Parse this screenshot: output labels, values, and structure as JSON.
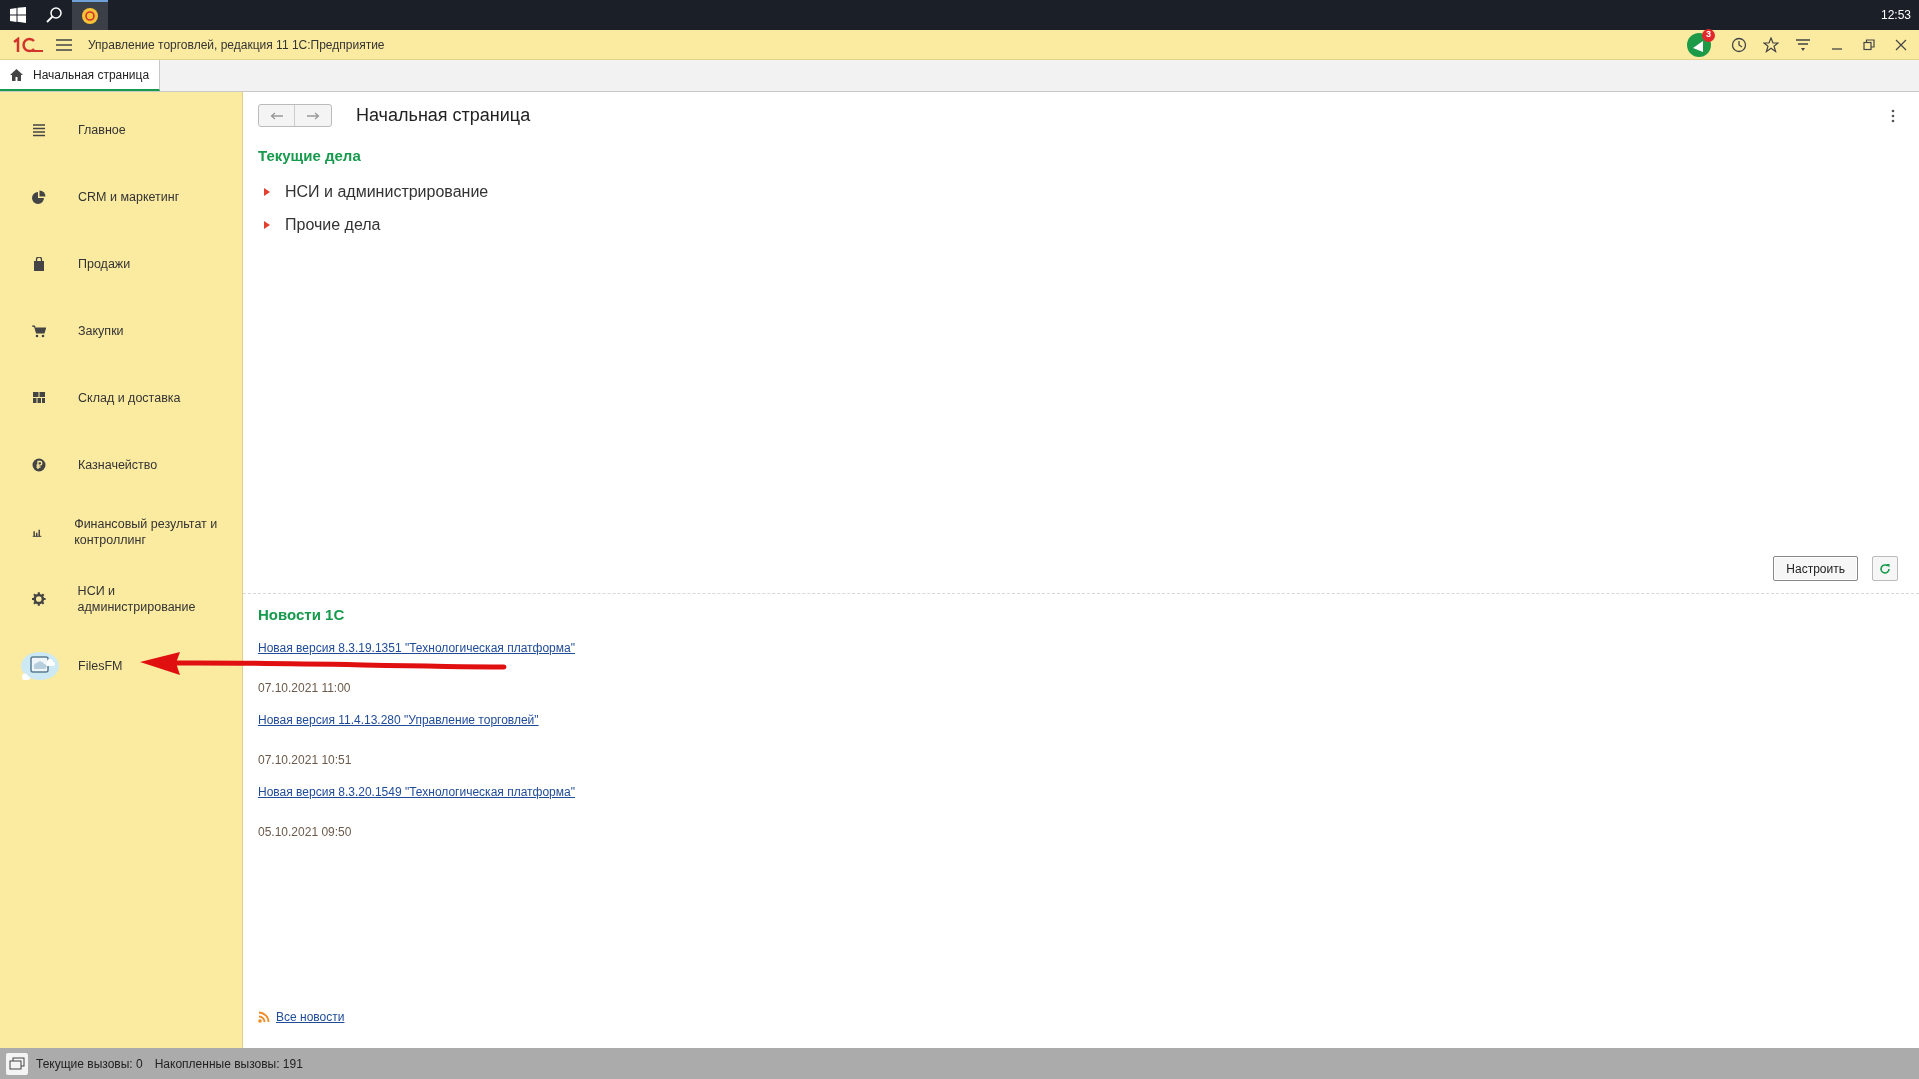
{
  "taskbar": {
    "clock": "12:53"
  },
  "app_header": {
    "title": "Управление торговлей, редакция 11 1С:Предприятие",
    "notification_count": "3"
  },
  "tabs": [
    {
      "label": "Начальная страница",
      "selected": true
    }
  ],
  "sidebar": {
    "items": [
      {
        "label": "Главное"
      },
      {
        "label": "CRM и маркетинг"
      },
      {
        "label": "Продажи"
      },
      {
        "label": "Закупки"
      },
      {
        "label": "Склад и доставка"
      },
      {
        "label": "Казначейство"
      },
      {
        "label": "Финансовый результат и контроллинг"
      },
      {
        "label": "НСИ и администрирование"
      },
      {
        "label": "FilesFM"
      }
    ]
  },
  "page": {
    "title": "Начальная страница",
    "current_tasks": {
      "title": "Текущие дела",
      "items": [
        {
          "label": "НСИ и администрирование",
          "expanded": false
        },
        {
          "label": "Прочие дела",
          "expanded": false
        }
      ]
    },
    "configure_button": "Настроить",
    "news": {
      "title": "Новости 1С",
      "items": [
        {
          "title": "Новая версия 8.3.19.1351 \"Технологическая платформа\"",
          "date": "07.10.2021 11:00"
        },
        {
          "title": "Новая версия 11.4.13.280 \"Управление торговлей\"",
          "date": "07.10.2021 10:51"
        },
        {
          "title": "Новая версия 8.3.20.1549 \"Технологическая платформа\"",
          "date": "05.10.2021 09:50"
        }
      ],
      "all_news": "Все новости"
    }
  },
  "status_bar": {
    "current_calls": "Текущие вызовы: 0",
    "accumulated_calls": "Накопленные вызовы: 191"
  }
}
